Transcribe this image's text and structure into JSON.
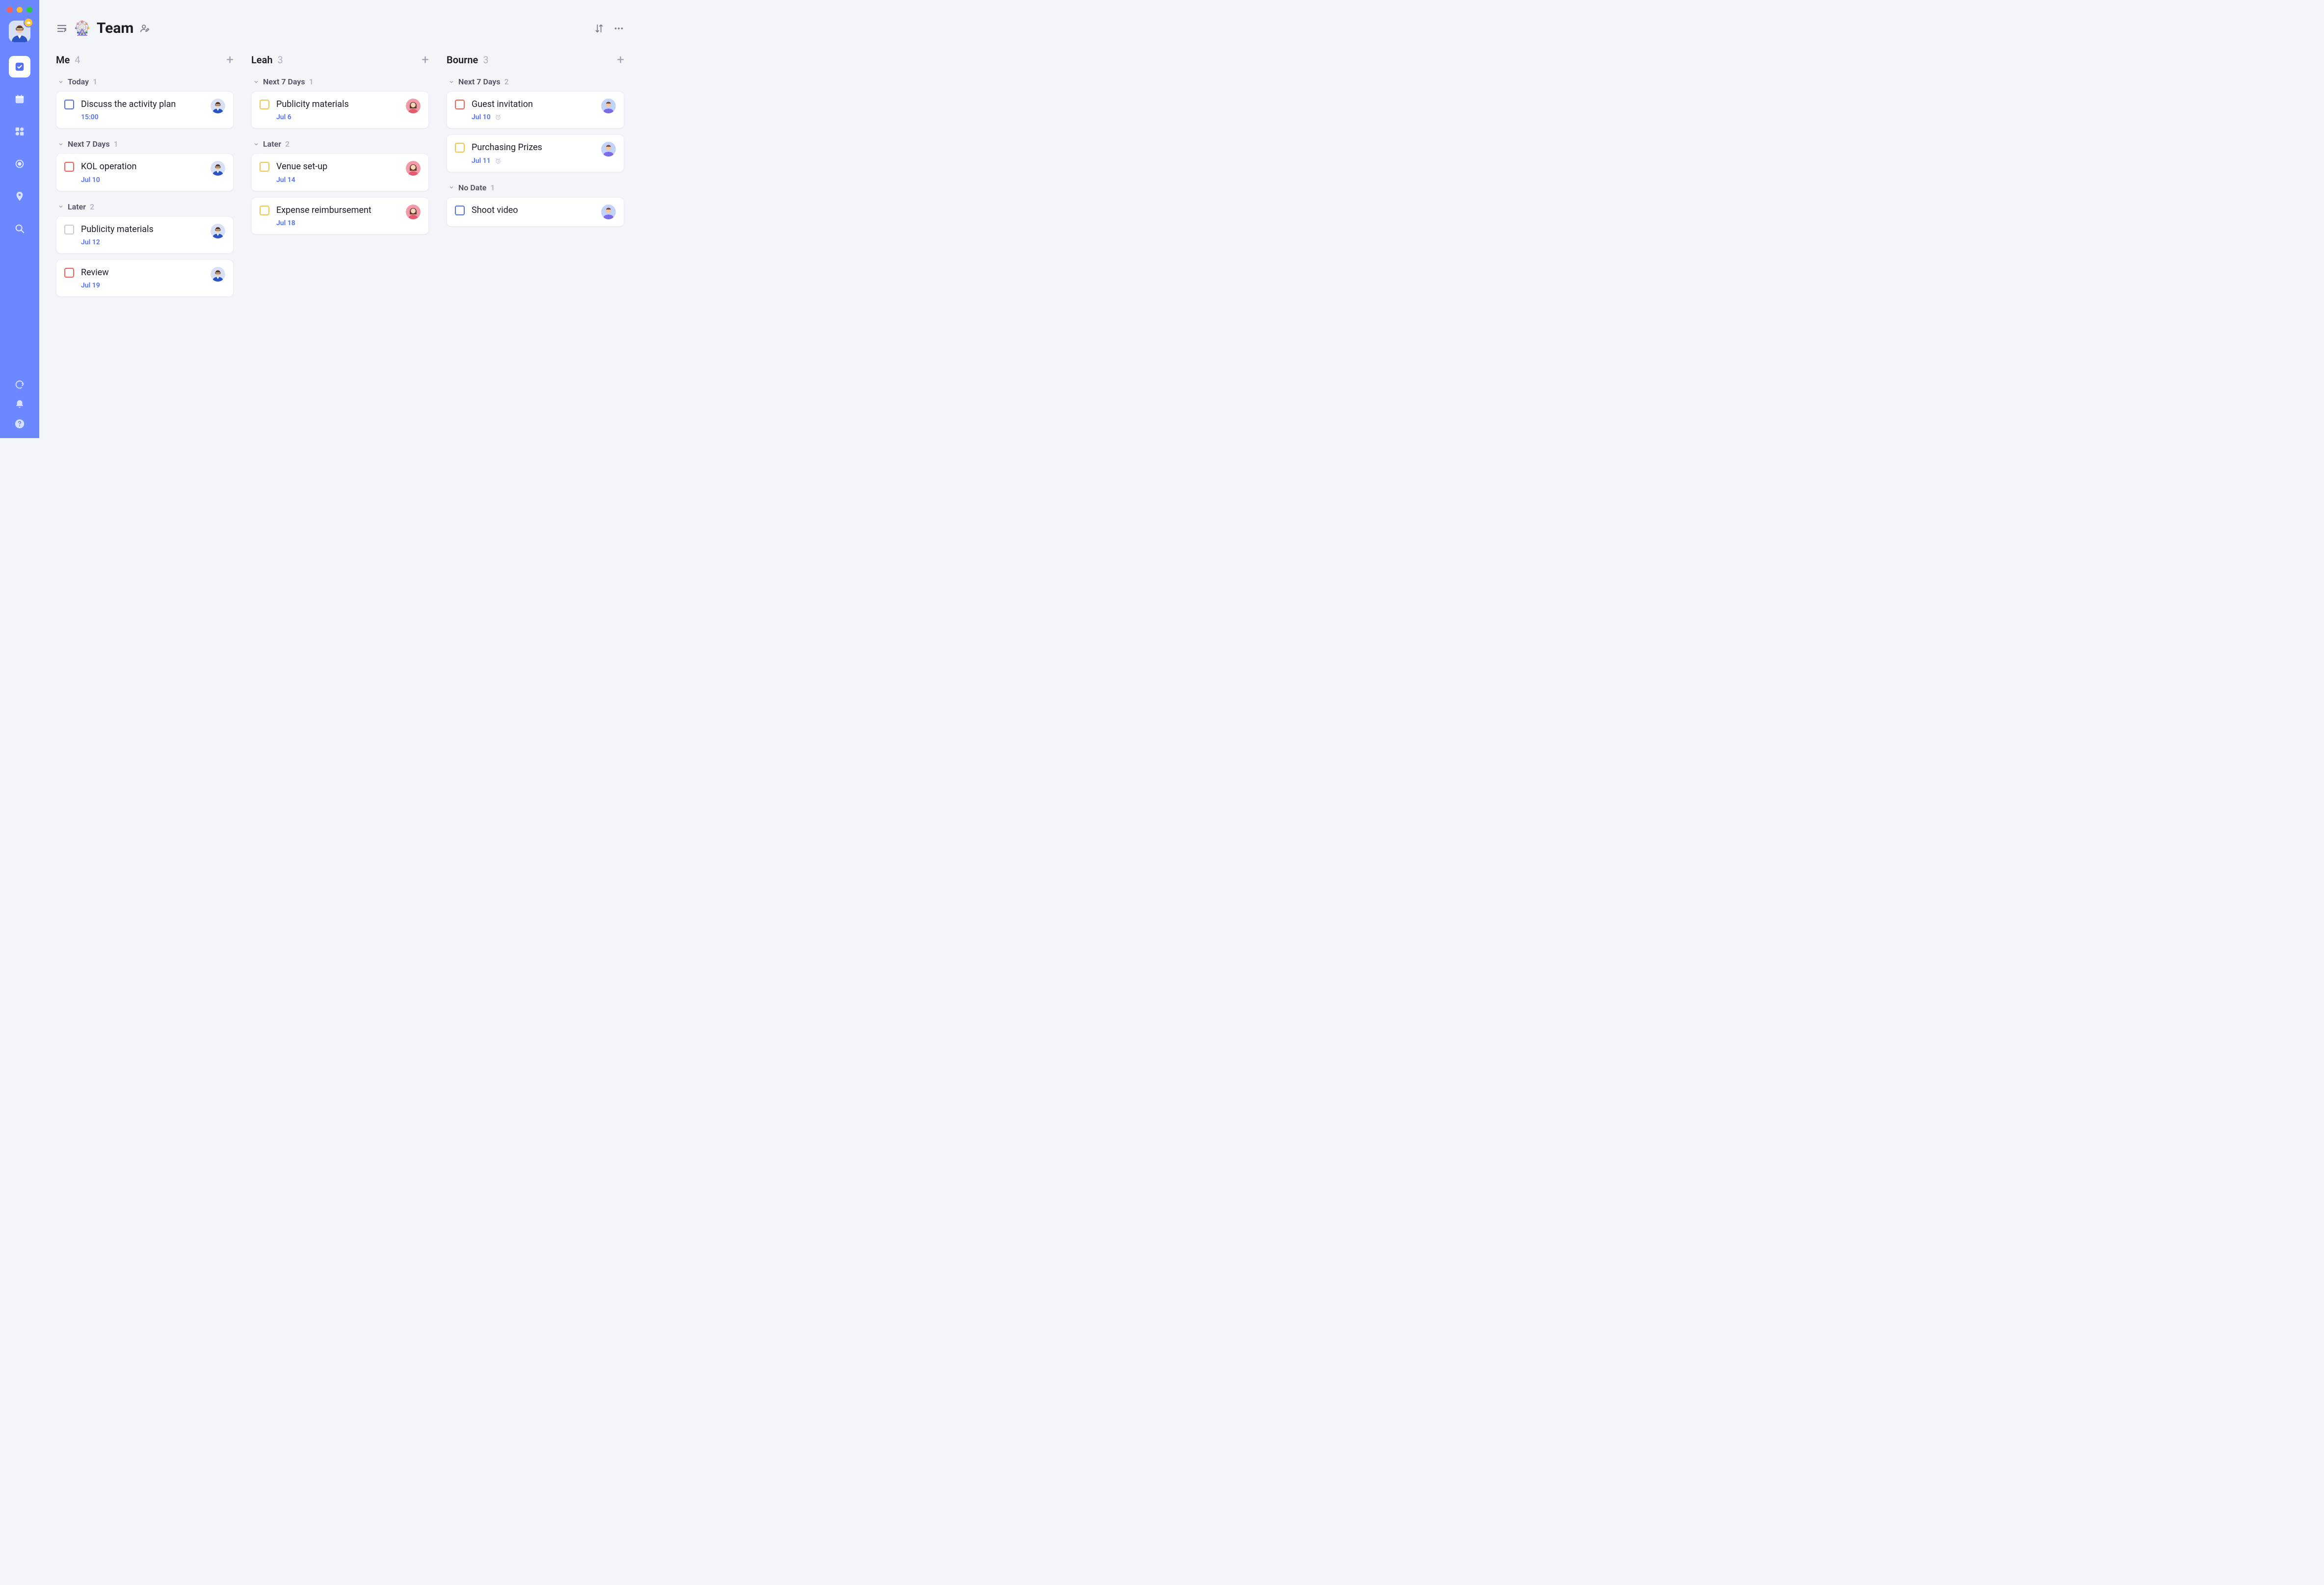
{
  "page_title": "Team",
  "columns": [
    {
      "name": "Me",
      "count": 4,
      "groups": [
        {
          "label": "Today",
          "count": 1,
          "tasks": [
            {
              "title": "Discuss the activity plan",
              "meta": "15:00",
              "priority": "low",
              "assignee": "me",
              "alarm": false
            }
          ]
        },
        {
          "label": "Next 7 Days",
          "count": 1,
          "tasks": [
            {
              "title": "KOL operation",
              "meta": "Jul 10",
              "priority": "high",
              "assignee": "me",
              "alarm": false
            }
          ]
        },
        {
          "label": "Later",
          "count": 2,
          "tasks": [
            {
              "title": "Publicity materials",
              "meta": "Jul 12",
              "priority": "none",
              "assignee": "me",
              "alarm": false
            },
            {
              "title": "Review",
              "meta": "Jul 19",
              "priority": "high",
              "assignee": "me",
              "alarm": false
            }
          ]
        }
      ]
    },
    {
      "name": "Leah",
      "count": 3,
      "groups": [
        {
          "label": "Next 7 Days",
          "count": 1,
          "tasks": [
            {
              "title": "Publicity materials",
              "meta": "Jul 6",
              "priority": "med",
              "assignee": "leah",
              "alarm": false
            }
          ]
        },
        {
          "label": "Later",
          "count": 2,
          "tasks": [
            {
              "title": "Venue set-up",
              "meta": "Jul 14",
              "priority": "med",
              "assignee": "leah",
              "alarm": false
            },
            {
              "title": "Expense reimbursement",
              "meta": "Jul 18",
              "priority": "med",
              "assignee": "leah",
              "alarm": false
            }
          ]
        }
      ]
    },
    {
      "name": "Bourne",
      "count": 3,
      "groups": [
        {
          "label": "Next 7 Days",
          "count": 2,
          "tasks": [
            {
              "title": "Guest invitation",
              "meta": "Jul 10",
              "priority": "high",
              "assignee": "bourne",
              "alarm": true
            },
            {
              "title": "Purchasing Prizes",
              "meta": "Jul 11",
              "priority": "med",
              "assignee": "bourne",
              "alarm": true
            }
          ]
        },
        {
          "label": "No Date",
          "count": 1,
          "tasks": [
            {
              "title": "Shoot video",
              "meta": "",
              "priority": "low",
              "assignee": "bourne",
              "alarm": false
            }
          ]
        }
      ]
    }
  ]
}
